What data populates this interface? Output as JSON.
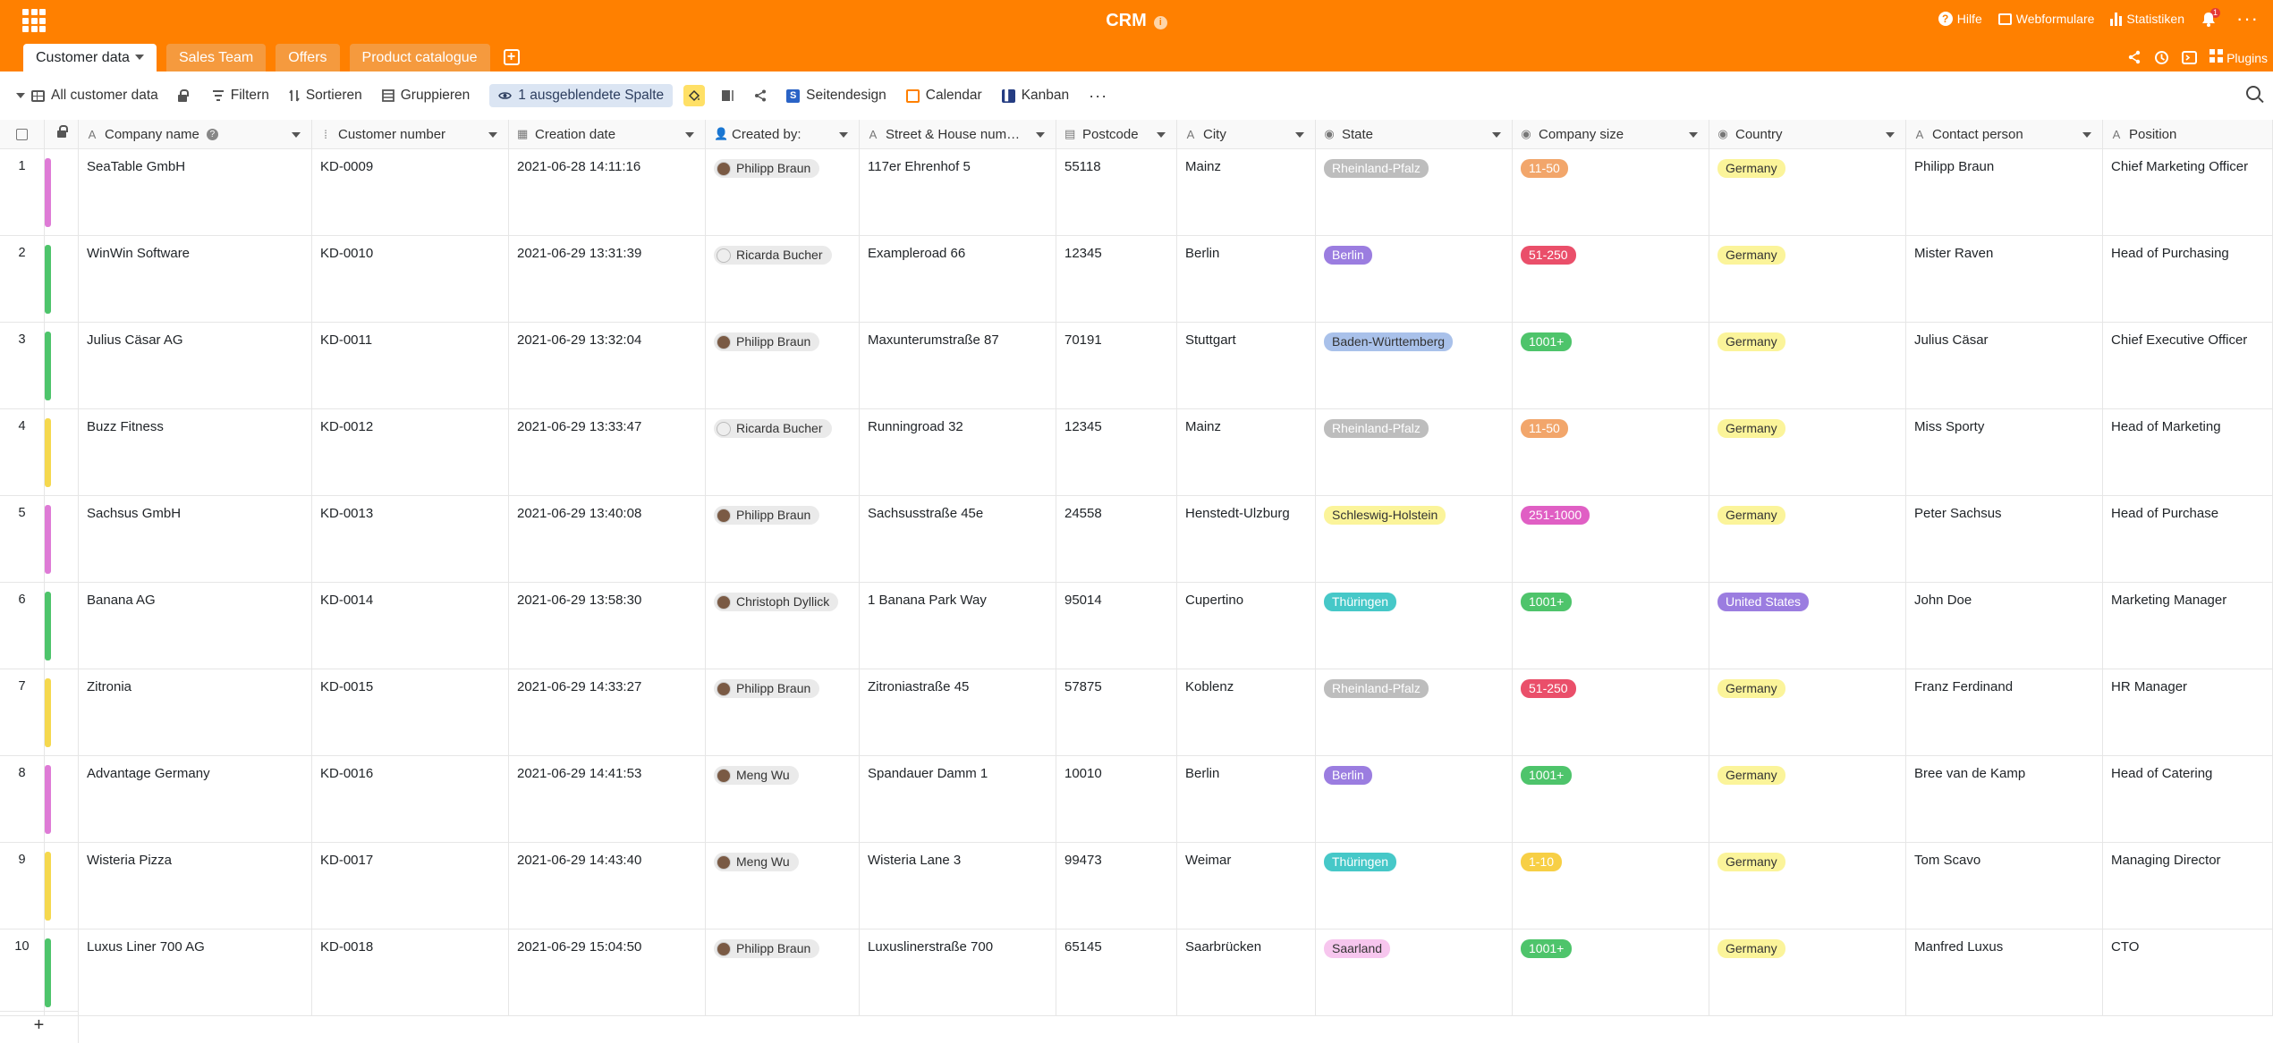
{
  "header": {
    "base_title": "CRM",
    "help_label": "Hilfe",
    "webforms_label": "Webformulare",
    "stats_label": "Statistiken",
    "notifications_count": "1",
    "plugins_label": "Plugins"
  },
  "tabs": [
    {
      "label": "Customer data",
      "active": true
    },
    {
      "label": "Sales Team",
      "active": false
    },
    {
      "label": "Offers",
      "active": false
    },
    {
      "label": "Product catalogue",
      "active": false
    }
  ],
  "toolbar": {
    "view_name": "All customer data",
    "filter_label": "Filtern",
    "sort_label": "Sortieren",
    "group_label": "Gruppieren",
    "hidden_columns_label": "1 ausgeblendete Spalte",
    "page_design_label": "Seitendesign",
    "calendar_label": "Calendar",
    "kanban_label": "Kanban"
  },
  "columns": [
    {
      "label": "Company name",
      "type": "A"
    },
    {
      "label": "Customer number",
      "type": "⁞"
    },
    {
      "label": "Creation date",
      "type": "▦"
    },
    {
      "label": "Created by:",
      "type": "👤"
    },
    {
      "label": "Street & House num…",
      "type": "A"
    },
    {
      "label": "Postcode",
      "type": "▤"
    },
    {
      "label": "City",
      "type": "A"
    },
    {
      "label": "State",
      "type": "◉"
    },
    {
      "label": "Company size",
      "type": "◉"
    },
    {
      "label": "Country",
      "type": "◉"
    },
    {
      "label": "Contact person",
      "type": "A"
    },
    {
      "label": "Position",
      "type": "A"
    }
  ],
  "colors": {
    "header_bg": "#ff8000",
    "state": {
      "Rheinland-Pfalz": "#bdbdbd",
      "Berlin": "#9b7de0",
      "Baden-Württemberg": "#a9c1ea",
      "Schleswig-Holstein": "#fbf49a",
      "Thüringen": "#46c8c8",
      "Saarland": "#f7c6ee"
    },
    "size": {
      "11-50": "#f2a66b",
      "51-250": "#ea4f6a",
      "1001+": "#4ec46b",
      "251-1000": "#e05fc4",
      "1-10": "#f7cf45"
    },
    "country": {
      "Germany": "#fbf49a",
      "United States": "#9b7de0"
    },
    "rowbar": {
      "pink": "#de7bd6",
      "green": "#4ec46b",
      "yellow": "#f5d84e"
    }
  },
  "rows": [
    {
      "num": "1",
      "bar": "pink",
      "company": "SeaTable GmbH",
      "customer_number": "KD-0009",
      "created": "2021-06-28 14:11:16",
      "created_by": "Philipp Braun",
      "avatar": "photo",
      "street": "117er Ehrenhof 5",
      "postcode": "55118",
      "city": "Mainz",
      "state": "Rheinland-Pfalz",
      "size": "11-50",
      "country": "Germany",
      "contact": "Philipp Braun",
      "position": "Chief Marketing Officer"
    },
    {
      "num": "2",
      "bar": "green",
      "company": "WinWin Software",
      "customer_number": "KD-0010",
      "created": "2021-06-29 13:31:39",
      "created_by": "Ricarda Bucher",
      "avatar": "ghost",
      "street": "Exampleroad 66",
      "postcode": "12345",
      "city": "Berlin",
      "state": "Berlin",
      "size": "51-250",
      "country": "Germany",
      "contact": "Mister Raven",
      "position": "Head of Purchasing"
    },
    {
      "num": "3",
      "bar": "green",
      "company": "Julius Cäsar AG",
      "customer_number": "KD-0011",
      "created": "2021-06-29 13:32:04",
      "created_by": "Philipp Braun",
      "avatar": "photo",
      "street": "Maxunterumstraße 87",
      "postcode": "70191",
      "city": "Stuttgart",
      "state": "Baden-Württemberg",
      "size": "1001+",
      "country": "Germany",
      "contact": "Julius Cäsar",
      "position": "Chief Executive Officer"
    },
    {
      "num": "4",
      "bar": "yellow",
      "company": "Buzz Fitness",
      "customer_number": "KD-0012",
      "created": "2021-06-29 13:33:47",
      "created_by": "Ricarda Bucher",
      "avatar": "ghost",
      "street": "Runningroad 32",
      "postcode": "12345",
      "city": "Mainz",
      "state": "Rheinland-Pfalz",
      "size": "11-50",
      "country": "Germany",
      "contact": "Miss Sporty",
      "position": "Head of Marketing"
    },
    {
      "num": "5",
      "bar": "pink",
      "company": "Sachsus GmbH",
      "customer_number": "KD-0013",
      "created": "2021-06-29 13:40:08",
      "created_by": "Philipp Braun",
      "avatar": "photo",
      "street": "Sachsusstraße 45e",
      "postcode": "24558",
      "city": "Henstedt-Ulzburg",
      "state": "Schleswig-Holstein",
      "size": "251-1000",
      "country": "Germany",
      "contact": "Peter Sachsus",
      "position": "Head of Purchase"
    },
    {
      "num": "6",
      "bar": "green",
      "company": "Banana AG",
      "customer_number": "KD-0014",
      "created": "2021-06-29 13:58:30",
      "created_by": "Christoph Dyllick",
      "avatar": "photo",
      "street": "1 Banana Park Way",
      "postcode": "95014",
      "city": "Cupertino",
      "state": "Thüringen",
      "size": "1001+",
      "country": "United States",
      "contact": "John Doe",
      "position": "Marketing Manager"
    },
    {
      "num": "7",
      "bar": "yellow",
      "company": "Zitronia",
      "customer_number": "KD-0015",
      "created": "2021-06-29 14:33:27",
      "created_by": "Philipp Braun",
      "avatar": "photo",
      "street": "Zitroniastraße 45",
      "postcode": "57875",
      "city": "Koblenz",
      "state": "Rheinland-Pfalz",
      "size": "51-250",
      "country": "Germany",
      "contact": "Franz Ferdinand",
      "position": "HR Manager"
    },
    {
      "num": "8",
      "bar": "pink",
      "company": "Advantage Germany",
      "customer_number": "KD-0016",
      "created": "2021-06-29 14:41:53",
      "created_by": "Meng Wu",
      "avatar": "photo",
      "street": "Spandauer Damm 1",
      "postcode": "10010",
      "city": "Berlin",
      "state": "Berlin",
      "size": "1001+",
      "country": "Germany",
      "contact": "Bree van de Kamp",
      "position": "Head of Catering"
    },
    {
      "num": "9",
      "bar": "yellow",
      "company": "Wisteria Pizza",
      "customer_number": "KD-0017",
      "created": "2021-06-29 14:43:40",
      "created_by": "Meng Wu",
      "avatar": "photo",
      "street": "Wisteria Lane 3",
      "postcode": "99473",
      "city": "Weimar",
      "state": "Thüringen",
      "size": "1-10",
      "country": "Germany",
      "contact": "Tom Scavo",
      "position": "Managing Director"
    },
    {
      "num": "10",
      "bar": "green",
      "company": "Luxus Liner 700 AG",
      "customer_number": "KD-0018",
      "created": "2021-06-29 15:04:50",
      "created_by": "Philipp Braun",
      "avatar": "photo",
      "street": "Luxuslinerstraße 700",
      "postcode": "65145",
      "city": "Saarbrücken",
      "state": "Saarland",
      "size": "1001+",
      "country": "Germany",
      "contact": "Manfred Luxus",
      "position": "CTO"
    }
  ],
  "add_row_label": "+"
}
